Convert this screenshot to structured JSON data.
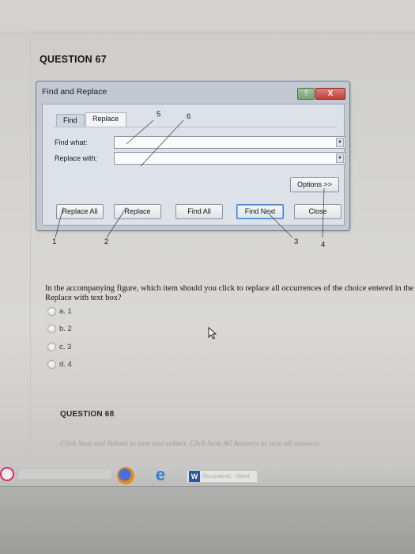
{
  "question": {
    "title": "QUESTION 67",
    "text": "In the accompanying figure, which item should you click to replace all occurrences of the choice entered in the Replace with text box?",
    "choices": [
      {
        "label": "a. 1"
      },
      {
        "label": "b. 2"
      },
      {
        "label": "c. 3"
      },
      {
        "label": "d. 4"
      }
    ]
  },
  "dialog": {
    "title": "Find and Replace",
    "help_label": "?",
    "close_label": "X",
    "tabs": [
      {
        "label": "Find"
      },
      {
        "label": "Replace"
      }
    ],
    "find_label": "Find what:",
    "replace_label": "Replace with:",
    "dropdown_glyph": "▼",
    "buttons": {
      "options": "Options >>",
      "replace_all": "Replace All",
      "replace": "Replace",
      "find_all": "Find All",
      "find_next": "Find Next",
      "close": "Close"
    }
  },
  "callouts": {
    "n1": "1",
    "n2": "2",
    "n3": "3",
    "n4": "4",
    "n5": "5",
    "n6": "6"
  },
  "next_question": {
    "title": "QUESTION 68"
  },
  "footer": {
    "note": "Click Save and Submit to save and submit. Click Save All Answers to save all answers."
  },
  "taskbar": {
    "edge_glyph": "e",
    "word_logo": "W",
    "word_label": "Document1 - Word"
  },
  "colors": {
    "dialog_bg": "#c3c9d3",
    "close_red": "#bf3f35",
    "help_green": "#78a174",
    "find_next_border": "#3e79c9"
  }
}
